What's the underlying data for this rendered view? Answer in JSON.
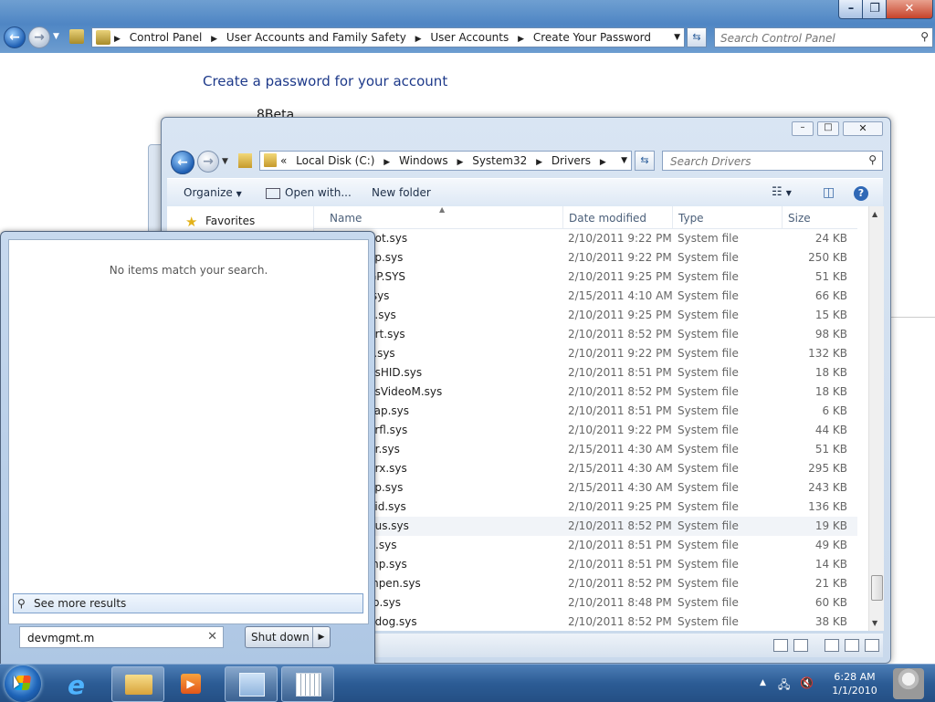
{
  "control_panel": {
    "breadcrumbs": [
      "Control Panel",
      "User Accounts and Family Safety",
      "User Accounts",
      "Create Your Password"
    ],
    "search_placeholder": "Search Control Panel",
    "page_title": "Create a password for your account",
    "user_name": "8Beta"
  },
  "explorer": {
    "breadcrumbs_prefix": "«",
    "breadcrumbs": [
      "Local Disk (C:)",
      "Windows",
      "System32",
      "Drivers"
    ],
    "search_placeholder": "Search Drivers",
    "toolbar": {
      "organize": "Organize",
      "open_with": "Open with...",
      "new_folder": "New folder"
    },
    "nav": {
      "favorites": "Favorites"
    },
    "columns": {
      "name": "Name",
      "date": "Date modified",
      "type": "Type",
      "size": "Size"
    },
    "files": [
      {
        "name": "bot.sys",
        "date": "2/10/2011 9:22 PM",
        "type": "System file",
        "size": "24 KB"
      },
      {
        "name": "ap.sys",
        "date": "2/10/2011 9:22 PM",
        "type": "System file",
        "size": "250 KB"
      },
      {
        "name": "GP.SYS",
        "date": "2/10/2011 9:25 PM",
        "type": "System file",
        "size": "51 KB"
      },
      {
        "name": ".sys",
        "date": "2/15/2011 4:10 AM",
        "type": "System file",
        "size": "66 KB"
      },
      {
        "name": "e.sys",
        "date": "2/10/2011 9:25 PM",
        "type": "System file",
        "size": "15 KB"
      },
      {
        "name": "prt.sys",
        "date": "2/10/2011 8:52 PM",
        "type": "System file",
        "size": "98 KB"
      },
      {
        "name": "s.sys",
        "date": "2/10/2011 9:22 PM",
        "type": "System file",
        "size": "132 KB"
      },
      {
        "name": "usHID.sys",
        "date": "2/10/2011 8:51 PM",
        "type": "System file",
        "size": "18 KB"
      },
      {
        "name": "usVideoM.sys",
        "date": "2/10/2011 8:52 PM",
        "type": "System file",
        "size": "18 KB"
      },
      {
        "name": "cap.sys",
        "date": "2/10/2011 8:51 PM",
        "type": "System file",
        "size": "6 KB"
      },
      {
        "name": "orfl.sys",
        "date": "2/10/2011 9:22 PM",
        "type": "System file",
        "size": "44 KB"
      },
      {
        "name": "gr.sys",
        "date": "2/15/2011 4:30 AM",
        "type": "System file",
        "size": "51 KB"
      },
      {
        "name": "grx.sys",
        "date": "2/15/2011 4:30 AM",
        "type": "System file",
        "size": "295 KB"
      },
      {
        "name": "ap.sys",
        "date": "2/15/2011 4:30 AM",
        "type": "System file",
        "size": "243 KB"
      },
      {
        "name": "aid.sys",
        "date": "2/10/2011 9:25 PM",
        "type": "System file",
        "size": "136 KB"
      },
      {
        "name": "bus.sys",
        "date": "2/10/2011 8:52 PM",
        "type": "System file",
        "size": "19 KB"
      },
      {
        "name": "lt.sys",
        "date": "2/10/2011 8:51 PM",
        "type": "System file",
        "size": "49 KB"
      },
      {
        "name": "mp.sys",
        "date": "2/10/2011 8:51 PM",
        "type": "System file",
        "size": "14 KB"
      },
      {
        "name": "mpen.sys",
        "date": "2/10/2011 8:52 PM",
        "type": "System file",
        "size": "21 KB"
      },
      {
        "name": "rp.sys",
        "date": "2/10/2011 8:48 PM",
        "type": "System file",
        "size": "60 KB"
      },
      {
        "name": "ndog.sys",
        "date": "2/10/2011 8:52 PM",
        "type": "System file",
        "size": "38 KB"
      }
    ],
    "selected_row": 15
  },
  "start_menu": {
    "no_items": "No items match your search.",
    "see_more": "See more results",
    "search_value": "devmgmt.m",
    "shutdown_label": "Shut down"
  },
  "taskbar": {
    "time": "6:28 AM",
    "date": "1/1/2010"
  }
}
